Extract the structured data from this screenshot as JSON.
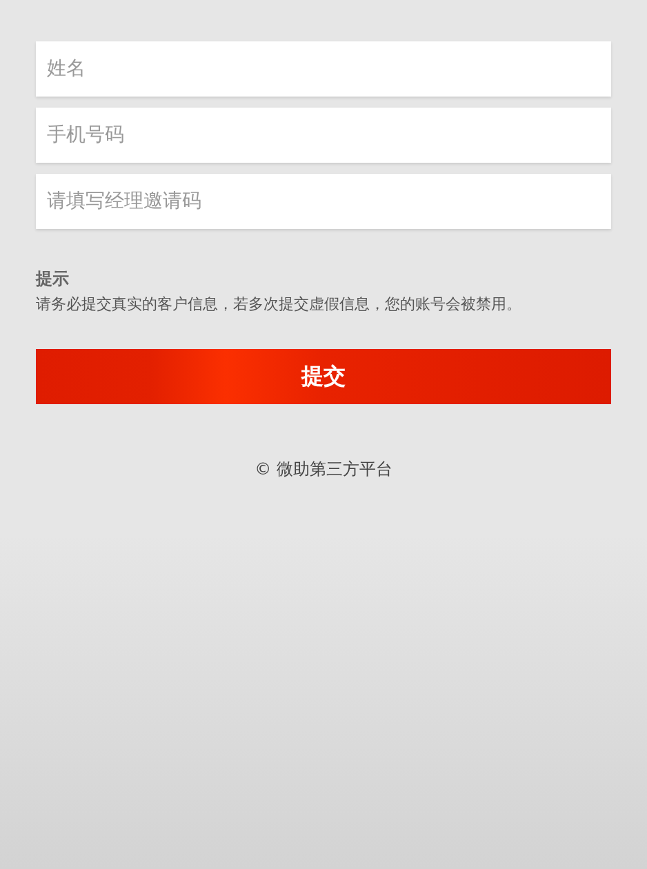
{
  "form": {
    "fields": [
      {
        "placeholder": "姓名"
      },
      {
        "placeholder": "手机号码"
      },
      {
        "placeholder": "请填写经理邀请码"
      }
    ]
  },
  "notice": {
    "title": "提示",
    "text": "请务必提交真实的客户信息，若多次提交虚假信息，您的账号会被禁用。"
  },
  "submit_button": "提交",
  "footer": "© 微助第三方平台"
}
